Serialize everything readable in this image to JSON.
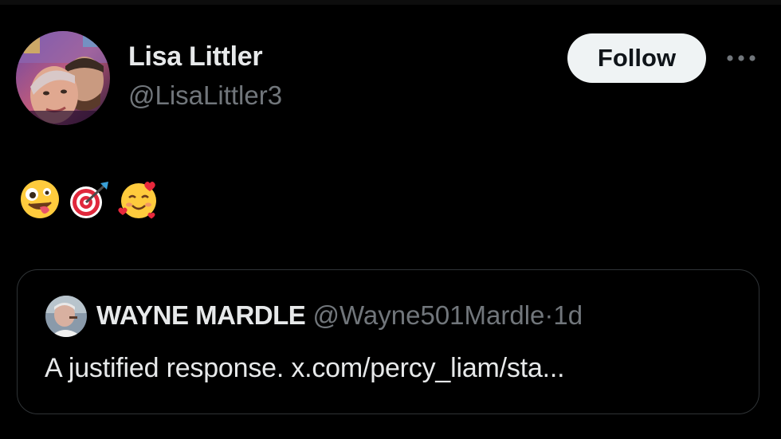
{
  "author": {
    "display_name": "Lisa Littler",
    "handle": "@LisaLittler3",
    "avatar_icon": "profile-photo-avatar"
  },
  "actions": {
    "follow_label": "Follow",
    "more_icon": "more-horizontal-icon"
  },
  "post": {
    "emojis": [
      "zany-face-emoji",
      "direct-hit-emoji",
      "smiling-face-with-hearts-emoji"
    ]
  },
  "quoted_post": {
    "display_name": "WAYNE MARDLE",
    "handle": "@Wayne501Mardle",
    "separator": "·",
    "time": "1d",
    "text": "A justified response. x.com/percy_liam/sta..."
  },
  "colors": {
    "background": "#000000",
    "primary_text": "#e7e9ea",
    "secondary_text": "#71767b",
    "border": "#2f3336",
    "follow_button_bg": "#eff3f4"
  }
}
